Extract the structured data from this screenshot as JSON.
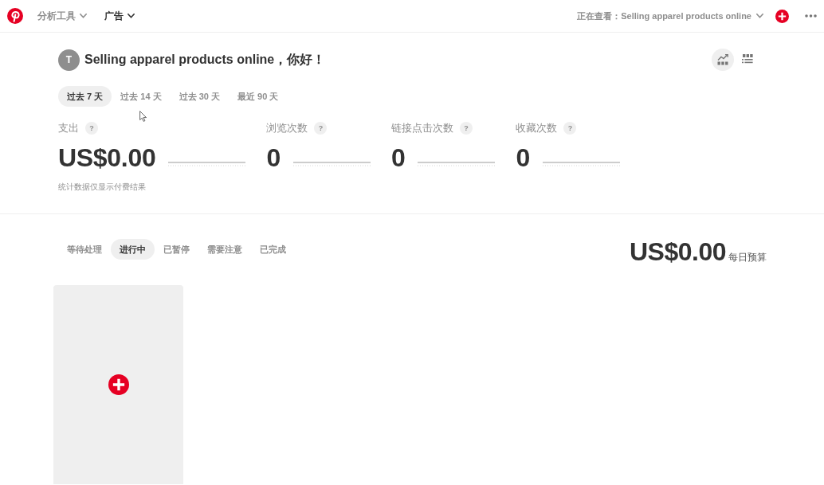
{
  "top_bar": {
    "nav": [
      {
        "label": "分析工具",
        "selected": false
      },
      {
        "label": "广告",
        "selected": true
      }
    ],
    "viewing": "正在查看：Selling apparel products online"
  },
  "header": {
    "avatar_letter": "T",
    "greeting": "Selling apparel products online，你好！",
    "views": [
      {
        "kind": "chart",
        "selected": true
      },
      {
        "kind": "list",
        "selected": false
      }
    ]
  },
  "date_ranges": [
    {
      "label": "过去 7 天",
      "selected": true
    },
    {
      "label": "过去 14 天",
      "selected": false
    },
    {
      "label": "过去 30 天",
      "selected": false
    },
    {
      "label": "最近 90 天",
      "selected": false
    }
  ],
  "metrics": [
    {
      "label": "支出",
      "help": "?",
      "value": "US$0.00"
    },
    {
      "label": "浏览次数",
      "help": "?",
      "value": "0"
    },
    {
      "label": "链接点击次数",
      "help": "?",
      "value": "0"
    },
    {
      "label": "收藏次数",
      "help": "?",
      "value": "0"
    }
  ],
  "note": "统计数据仅显示付费结果",
  "status_tabs": [
    {
      "label": "等待处理",
      "selected": false
    },
    {
      "label": "进行中",
      "selected": true
    },
    {
      "label": "已暂停",
      "selected": false
    },
    {
      "label": "需要注意",
      "selected": false
    },
    {
      "label": "已完成",
      "selected": false
    }
  ],
  "budget": {
    "amount": "US$0.00",
    "label": "每日预算"
  }
}
